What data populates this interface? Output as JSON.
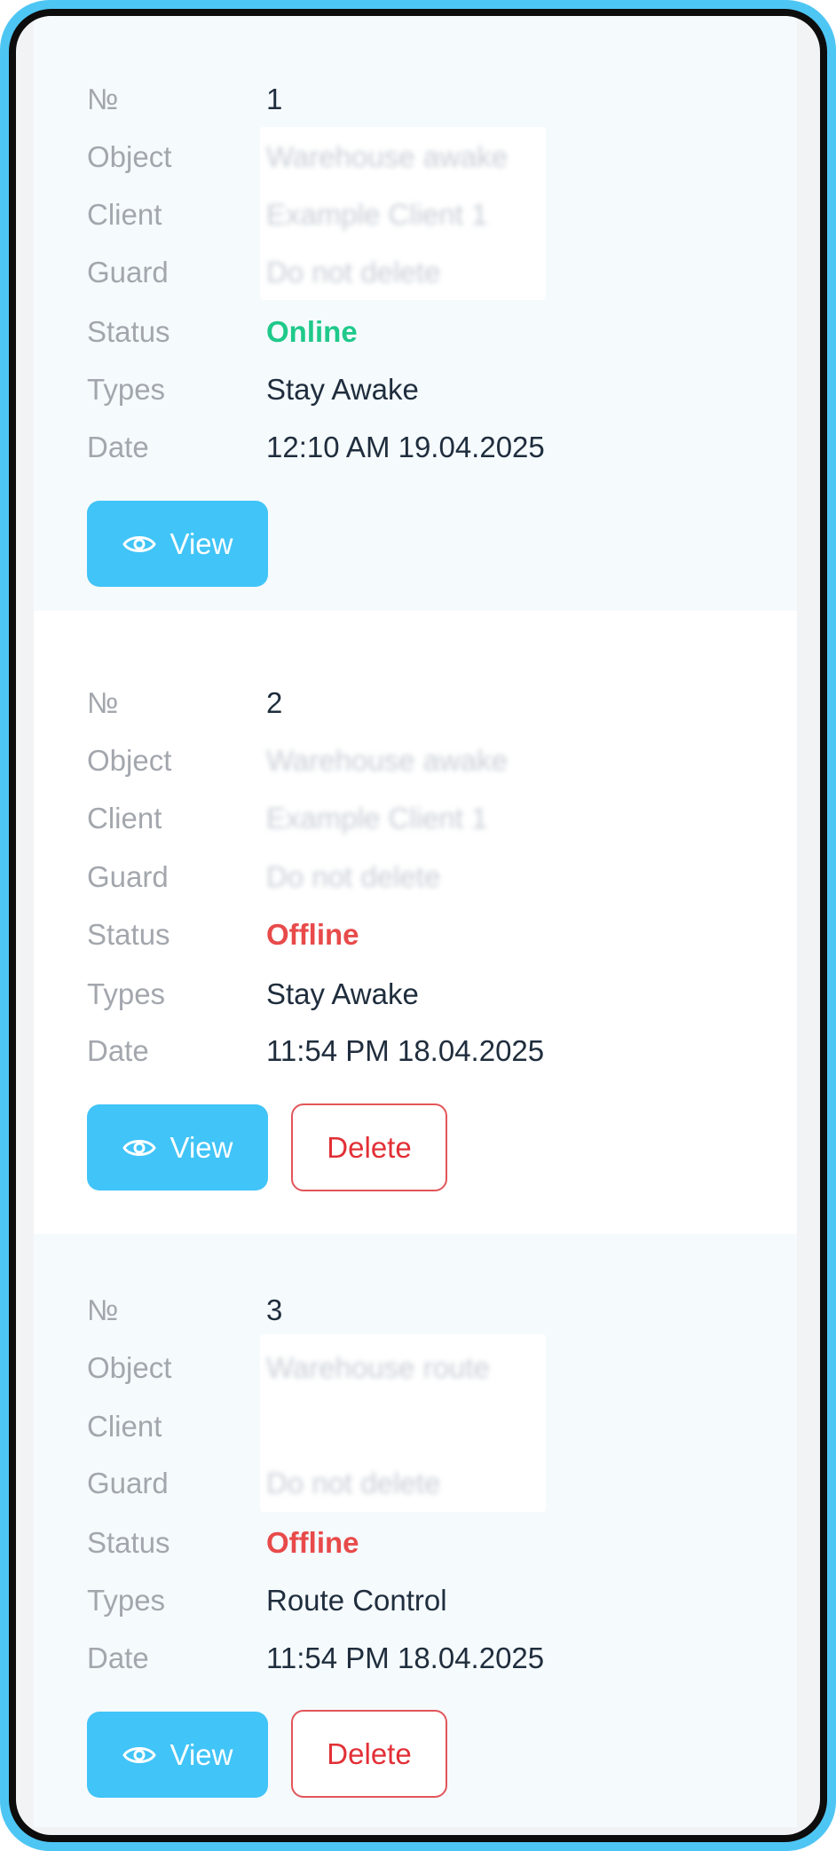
{
  "labels": {
    "number": "№",
    "object": "Object",
    "client": "Client",
    "guard": "Guard",
    "status": "Status",
    "types": "Types",
    "date": "Date"
  },
  "buttons": {
    "view": "View",
    "delete": "Delete"
  },
  "records": [
    {
      "number": "1",
      "object": "Warehouse awake",
      "client": "Example Client 1",
      "guard": "Do not delete",
      "status": "Online",
      "type": "Stay Awake",
      "date": "12:10 AM 19.04.2025"
    },
    {
      "number": "2",
      "object": "Warehouse awake",
      "client": "Example Client 1",
      "guard": "Do not delete",
      "status": "Offline",
      "type": "Stay Awake",
      "date": "11:54 PM 18.04.2025"
    },
    {
      "number": "3",
      "object": "Warehouse route",
      "client": "",
      "guard": "Do not delete",
      "status": "Offline",
      "type": "Route Control",
      "date": "11:54 PM 18.04.2025"
    }
  ],
  "colors": {
    "accent": "#41c4f7",
    "online": "#1fc98a",
    "offline": "#e84a4a",
    "delete_border": "#e2555a"
  },
  "icons": {
    "view": "eye-icon"
  }
}
